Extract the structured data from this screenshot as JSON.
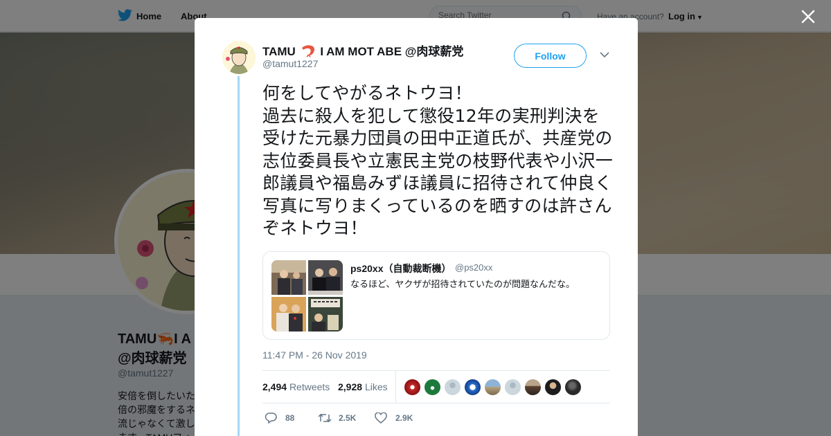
{
  "nav": {
    "home_label": "Home",
    "about_label": "About",
    "search_placeholder": "Search Twitter",
    "have_account": "Have an account?",
    "login_label": "Log in"
  },
  "background_profile": {
    "name": "TAMU🦐I A",
    "name_line2": "@肉球薪党",
    "handle": "@tamut1227",
    "bio": "安倍を倒したいた 倍の邪魔をするネ 流じゃなくて激し ます。TAMUフォ"
  },
  "tweet": {
    "author_name_prefix": "TAMU",
    "author_name_suffix": "I AM MOT ABE @肉球薪党",
    "author_handle": "@tamut1227",
    "follow_label": "Follow",
    "text": "何をしてやがるネトウヨ！\n過去に殺人を犯して懲役12年の実刑判決を受けた元暴力団員の田中正道氏が、共産党の志位委員長や立憲民主党の枝野代表や小沢一郎議員や福島みずほ議員に招待されて仲良く写真に写りまくっているのを晒すのは許さんぞネトウヨ！",
    "quote": {
      "name": "ps20xx（自動裁断機）",
      "handle": "@ps20xx",
      "text": "なるほど、ヤクザが招待されていたのが問題なんだな。"
    },
    "timestamp": "11:47 PM - 26 Nov 2019",
    "retweets_count": "2,494",
    "retweets_label": "Retweets",
    "likes_count": "2,928",
    "likes_label": "Likes",
    "replies": "88",
    "retweets_short": "2.5K",
    "likes_short": "2.9K"
  },
  "colors": {
    "accent": "#1da1f2",
    "thread": "#a3d8f4",
    "secondary_text": "#657786"
  }
}
